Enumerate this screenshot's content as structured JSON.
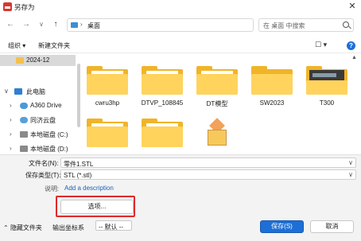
{
  "window": {
    "title": "另存为",
    "close_glyph": "✕"
  },
  "nav": {
    "back": "←",
    "forward": "→",
    "dropdown": "∨",
    "up": "↑",
    "address": "桌面",
    "address_chevron": "›",
    "address_dropdown": "∨",
    "refresh": "↻",
    "search_placeholder": "在 桌面 中搜索"
  },
  "toolbar": {
    "organize": "组织 ▾",
    "new_folder": "新建文件夹",
    "view": "☐ ▾",
    "help": "?"
  },
  "sidebar": {
    "items": [
      {
        "label": "2024-12",
        "icon": "folder-icon",
        "selected": true
      },
      {
        "label": "此电脑",
        "icon": "computer-icon",
        "chevron": "∨"
      },
      {
        "label": "A360 Drive",
        "icon": "cloud-icon",
        "chevron": "›"
      },
      {
        "label": "同济云盘",
        "icon": "cloud-sync-icon",
        "chevron": "›"
      },
      {
        "label": "本地磁盘 (C:)",
        "icon": "drive-icon",
        "chevron": "›"
      },
      {
        "label": "本地磁盘 (D:)",
        "icon": "drive-icon",
        "chevron": "›"
      }
    ]
  },
  "files": [
    {
      "name": "cwru3hp",
      "kind": "folder-paper"
    },
    {
      "name": "DTVP_108845",
      "kind": "folder-paper"
    },
    {
      "name": "DT模型",
      "kind": "folder-paper"
    },
    {
      "name": "SW2023",
      "kind": "folder"
    },
    {
      "name": "T300",
      "kind": "folder-photo"
    },
    {
      "name": "",
      "kind": "folder-paper"
    },
    {
      "name": "",
      "kind": "folder-paper"
    },
    {
      "name": "",
      "kind": "part-cube"
    }
  ],
  "form": {
    "filename_label": "文件名(N):",
    "filename_value": "零件1.STL",
    "filetype_label": "保存类型(T):",
    "filetype_value": "STL (*.stl)",
    "description_label": "说明:",
    "description_link": "Add a description",
    "options_button": "选项...",
    "coord_label": "输出坐标系",
    "coord_value": "-- 默认 --",
    "hide_folders": "隐藏文件夹",
    "save_button": "保存(S)",
    "cancel_button": "取消"
  },
  "colors": {
    "accent": "#1d6fd6",
    "highlight": "#e02a2a",
    "folder": "#f0b429"
  }
}
